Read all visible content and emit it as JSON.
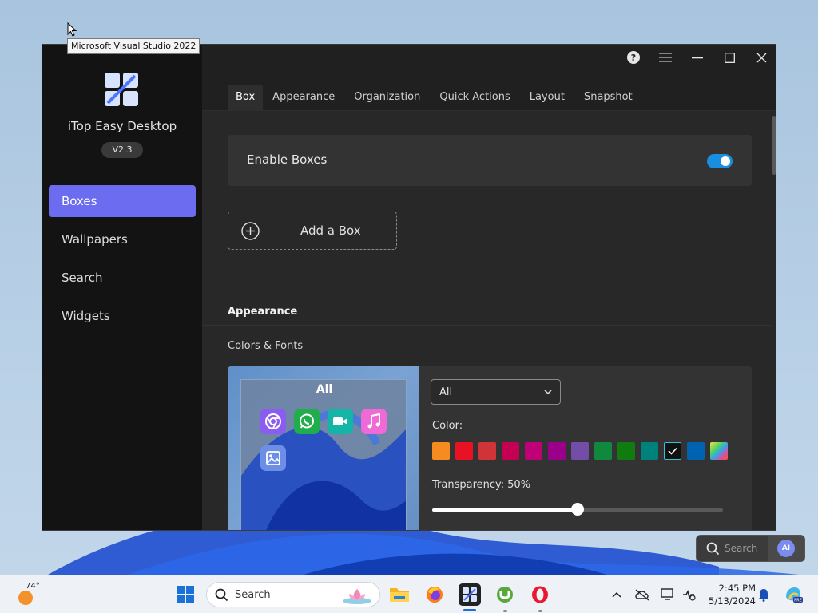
{
  "tooltip": {
    "text": "Microsoft Visual Studio 2022"
  },
  "app": {
    "name": "iTop Easy Desktop",
    "version": "V2.3",
    "nav": [
      {
        "label": "Boxes",
        "active": true
      },
      {
        "label": "Wallpapers",
        "active": false
      },
      {
        "label": "Search",
        "active": false
      },
      {
        "label": "Widgets",
        "active": false
      }
    ],
    "tabs": [
      {
        "label": "Box",
        "active": true
      },
      {
        "label": "Appearance",
        "active": false
      },
      {
        "label": "Organization",
        "active": false
      },
      {
        "label": "Quick Actions",
        "active": false
      },
      {
        "label": "Layout",
        "active": false
      },
      {
        "label": "Snapshot",
        "active": false
      }
    ],
    "enable_boxes": {
      "label": "Enable Boxes",
      "on": true
    },
    "add_box": {
      "label": "Add a Box"
    },
    "appearance": {
      "section_title": "Appearance",
      "subtitle": "Colors & Fonts",
      "preview_title": "All",
      "select_value": "All",
      "color_label": "Color:",
      "colors": [
        "#f68c1f",
        "#e81224",
        "#d13438",
        "#c30052",
        "#bf0077",
        "#9a0089",
        "#744da9",
        "#10893e",
        "#107c10",
        "#00827c",
        "#111111",
        "#0063b1"
      ],
      "selected_color_index": 10,
      "transparency_label": "Transparency:",
      "transparency_value": "50%",
      "transparency_fraction": 0.5
    }
  },
  "float_search": {
    "label": "Search",
    "ai": "AI"
  },
  "taskbar": {
    "weather_temp": "74°",
    "search_label": "Search",
    "time": "2:45 PM",
    "date": "5/13/2024"
  },
  "colors": {
    "accent": "#6c6cf0",
    "toggle": "#1a8fe0"
  }
}
